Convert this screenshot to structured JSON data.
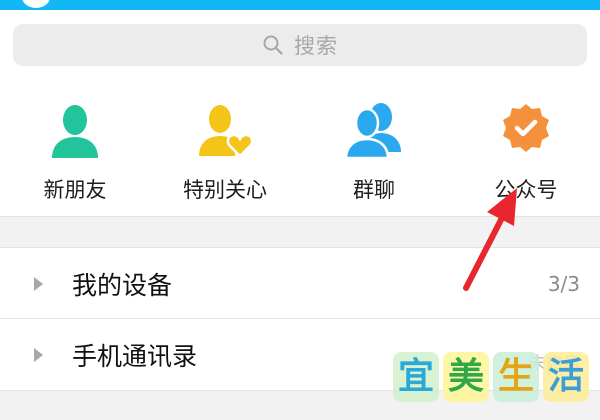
{
  "search": {
    "placeholder": "搜索"
  },
  "shortcuts": [
    {
      "label": "新朋友",
      "icon": "new-friend-icon",
      "color": "#22c49c"
    },
    {
      "label": "特别关心",
      "icon": "special-care-icon",
      "color": "#f5c419"
    },
    {
      "label": "群聊",
      "icon": "group-chat-icon",
      "color": "#2aa8f0"
    },
    {
      "label": "公众号",
      "icon": "official-account-icon",
      "color": "#f5903d"
    }
  ],
  "list": [
    {
      "label": "我的设备",
      "count": "3/3"
    },
    {
      "label": "手机通讯录",
      "count": "未启用"
    }
  ],
  "watermark": {
    "text": [
      "宜",
      "美",
      "生",
      "活"
    ]
  },
  "colors": {
    "accent": "#12b7f5",
    "annotation": "#e8262e"
  }
}
